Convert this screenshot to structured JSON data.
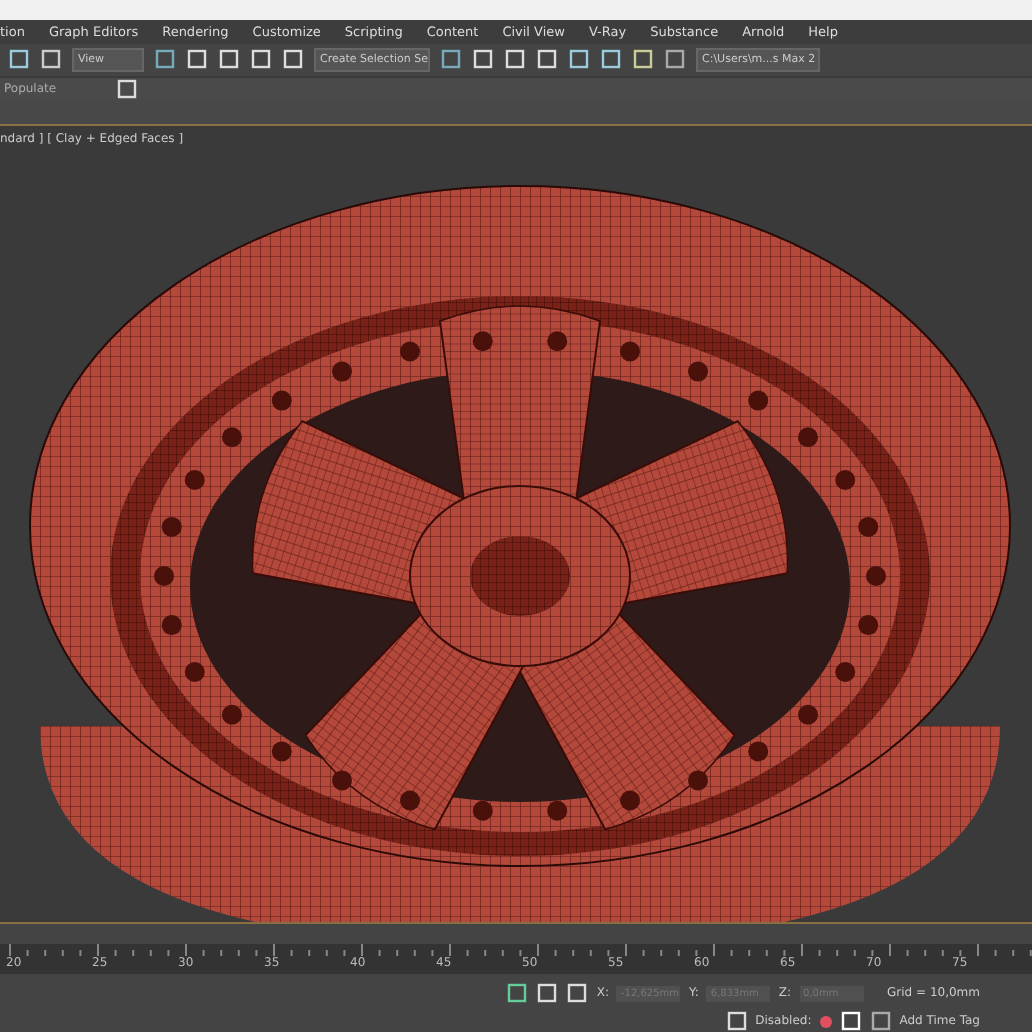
{
  "menu": [
    "tion",
    "Graph Editors",
    "Rendering",
    "Customize",
    "Scripting",
    "Content",
    "Civil View",
    "V-Ray",
    "Substance",
    "Arnold",
    "Help"
  ],
  "toolbar": {
    "view_dropdown": "View",
    "selection_set": "Create Selection Se",
    "path": "C:\\Users\\m...s Max 2"
  },
  "ribbon": {
    "label": "Populate"
  },
  "viewport": {
    "label": "ndard ] [ Clay + Edged Faces ]"
  },
  "timeline": {
    "ticks": [
      "20",
      "25",
      "30",
      "35",
      "40",
      "45",
      "50",
      "55",
      "60",
      "65",
      "70",
      "75"
    ]
  },
  "status": {
    "x_label": "X:",
    "y_label": "Y:",
    "z_label": "Z:",
    "x": "-12,625mm",
    "y": "6,833mm",
    "z": "0,0mm",
    "grid": "Grid = 10,0mm",
    "disabled_label": "Disabled:",
    "time_tag": "Add Time Tag"
  }
}
